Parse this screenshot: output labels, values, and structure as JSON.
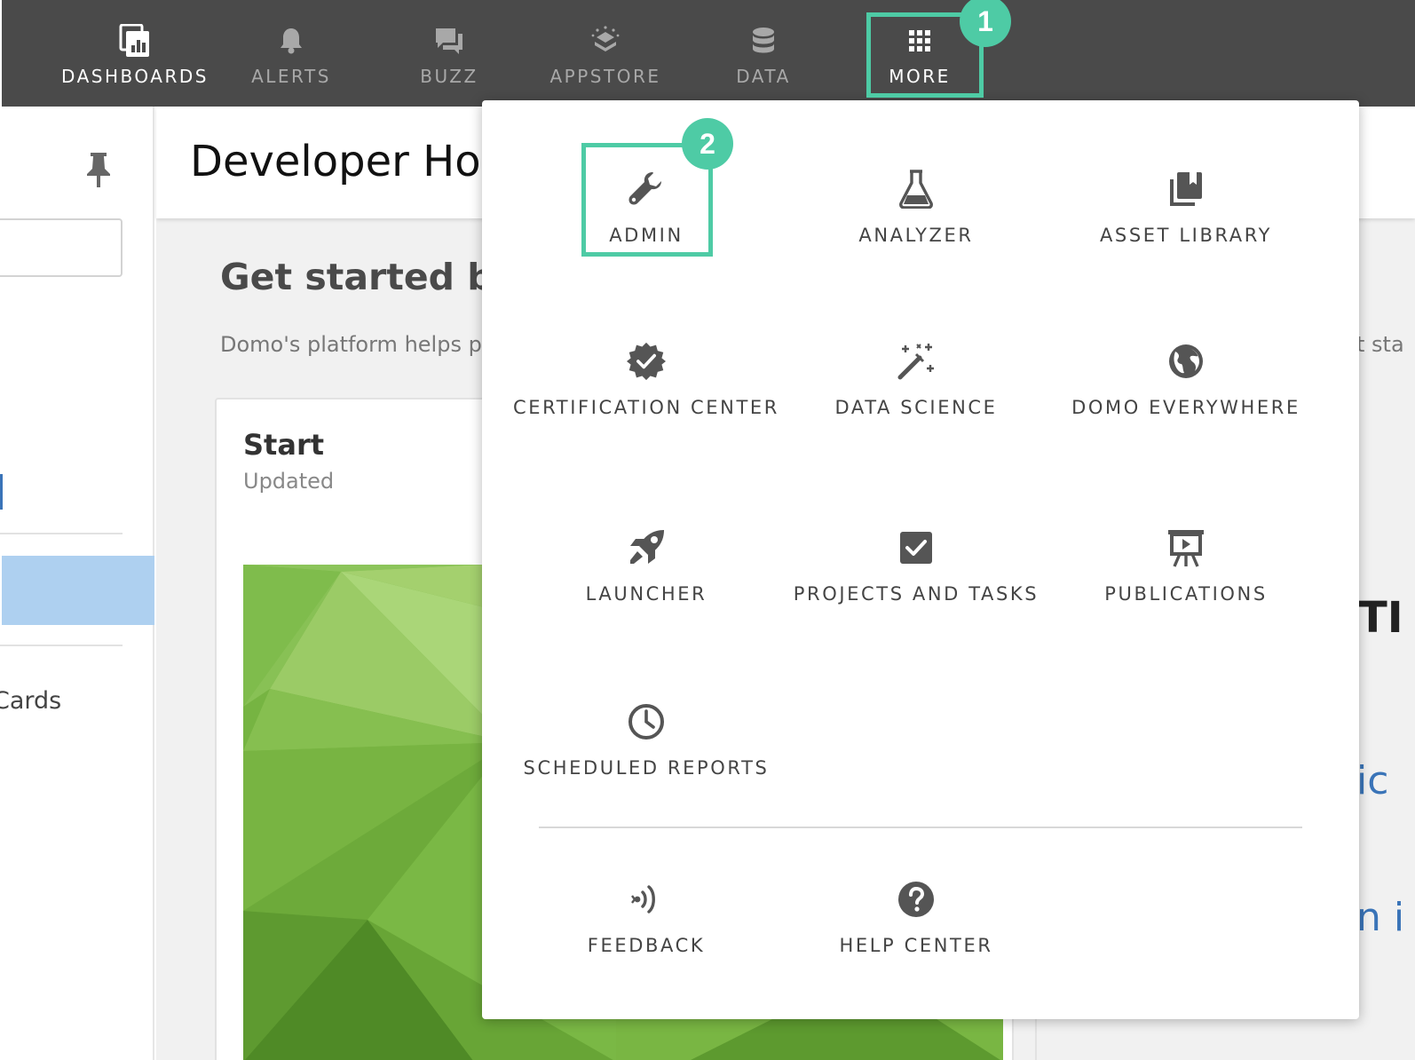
{
  "nav": {
    "items": [
      {
        "label": "DASHBOARDS",
        "icon": "dashboards-icon",
        "active": true
      },
      {
        "label": "ALERTS",
        "icon": "bell-icon",
        "active": false
      },
      {
        "label": "BUZZ",
        "icon": "chat-icon",
        "active": false
      },
      {
        "label": "APPSTORE",
        "icon": "appstore-icon",
        "active": false
      },
      {
        "label": "DATA",
        "icon": "database-icon",
        "active": false
      },
      {
        "label": "MORE",
        "icon": "grid-icon",
        "active": false
      }
    ]
  },
  "annotations": {
    "step1": "1",
    "step2": "2",
    "highlight_color": "#4ecba5"
  },
  "page": {
    "title": "Developer Hom",
    "hero_title": "Get started bui",
    "hero_sub": "Domo's platform helps peo",
    "hero_sub_right": "t sta",
    "sidebar_cards_label": "Cards",
    "right_title_fragment": "TI",
    "right_link_fragment_1": "ic",
    "right_link_fragment_2": "n i"
  },
  "start_card": {
    "title": "Start",
    "subtitle": "Updated"
  },
  "menu": {
    "items": [
      {
        "label": "ADMIN",
        "icon": "wrench-icon"
      },
      {
        "label": "ANALYZER",
        "icon": "flask-icon"
      },
      {
        "label": "ASSET LIBRARY",
        "icon": "library-icon"
      },
      {
        "label": "CERTIFICATION CENTER",
        "icon": "certified-badge-icon"
      },
      {
        "label": "DATA SCIENCE",
        "icon": "magic-wand-icon"
      },
      {
        "label": "DOMO EVERYWHERE",
        "icon": "globe-icon"
      },
      {
        "label": "LAUNCHER",
        "icon": "rocket-icon"
      },
      {
        "label": "PROJECTS AND TASKS",
        "icon": "checkbox-icon"
      },
      {
        "label": "PUBLICATIONS",
        "icon": "presentation-icon"
      },
      {
        "label": "SCHEDULED REPORTS",
        "icon": "clock-icon"
      }
    ],
    "footer_items": [
      {
        "label": "FEEDBACK",
        "icon": "feedback-icon"
      },
      {
        "label": "HELP CENTER",
        "icon": "help-icon"
      }
    ]
  },
  "colors": {
    "topbar": "#4a4a4a",
    "accent": "#4ecba5",
    "selected_row": "#aed0f0",
    "icon": "#555555"
  }
}
